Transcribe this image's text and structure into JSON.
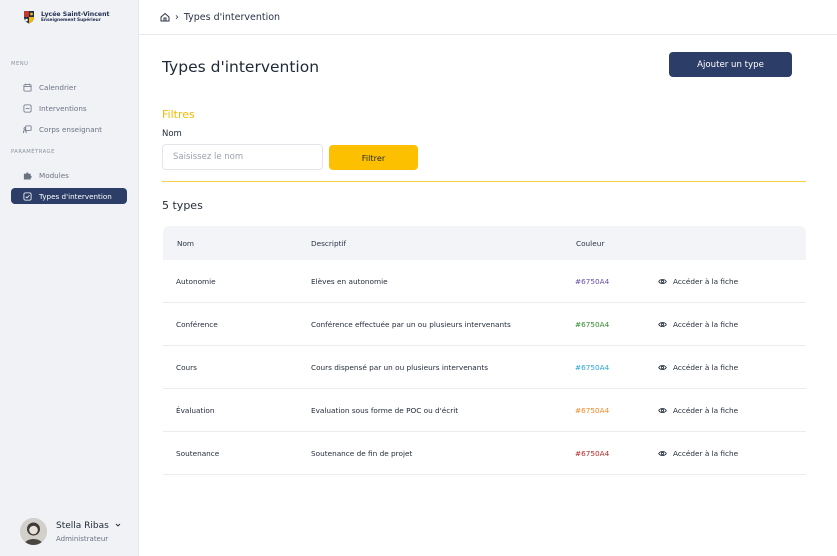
{
  "brand": {
    "name": "Lycée Saint-Vincent",
    "subtitle": "Enseignement Supérieur"
  },
  "sidebar": {
    "menu_label": "MENU",
    "menu_items": [
      {
        "label": "Calendrier",
        "icon": "calendar-icon"
      },
      {
        "label": "Interventions",
        "icon": "interventions-icon"
      },
      {
        "label": "Corps enseignant",
        "icon": "teacher-board-icon"
      }
    ],
    "settings_label": "PARAMÉTRAGE",
    "settings_items": [
      {
        "label": "Modules",
        "icon": "puzzle-icon"
      },
      {
        "label": "Types d'intervention",
        "icon": "checklist-icon",
        "active": true
      }
    ]
  },
  "user": {
    "name": "Stella Ribas",
    "role": "Administrateur"
  },
  "breadcrumb": {
    "current": "Types d'intervention"
  },
  "page": {
    "title": "Types d'intervention",
    "add_button": "Ajouter un type"
  },
  "filters": {
    "title": "Filtres",
    "name_label": "Nom",
    "name_placeholder": "Saisissez le nom",
    "filter_button": "Filtrer"
  },
  "list": {
    "count_label": "5 types",
    "columns": {
      "name": "Nom",
      "description": "Descriptif",
      "color": "Couleur"
    },
    "rows": [
      {
        "name": "Autonomie",
        "description": "Elèves en autonomie",
        "color": "#6750A4",
        "display_color": "#6750a4",
        "link": "Accéder à la fiche"
      },
      {
        "name": "Conférence",
        "description": "Conférence effectuée par un ou plusieurs intervenants",
        "color": "#6750A4",
        "display_color": "#2e8b2e",
        "link": "Accéder à la fiche"
      },
      {
        "name": "Cours",
        "description": "Cours dispensé par un ou plusieurs intervenants",
        "color": "#6750A4",
        "display_color": "#2aa7d6",
        "link": "Accéder à la fiche"
      },
      {
        "name": "Évaluation",
        "description": "Evaluation sous forme de POC ou d'écrit",
        "color": "#6750A4",
        "display_color": "#f08a24",
        "link": "Accéder à la fiche"
      },
      {
        "name": "Soutenance",
        "description": "Soutenance de fin de projet",
        "color": "#6750A4",
        "display_color": "#b32929",
        "link": "Accéder à la fiche"
      }
    ]
  },
  "colors": {
    "primary": "#2c3e67",
    "accent": "#fdc000",
    "filters_title": "#f5b800"
  }
}
